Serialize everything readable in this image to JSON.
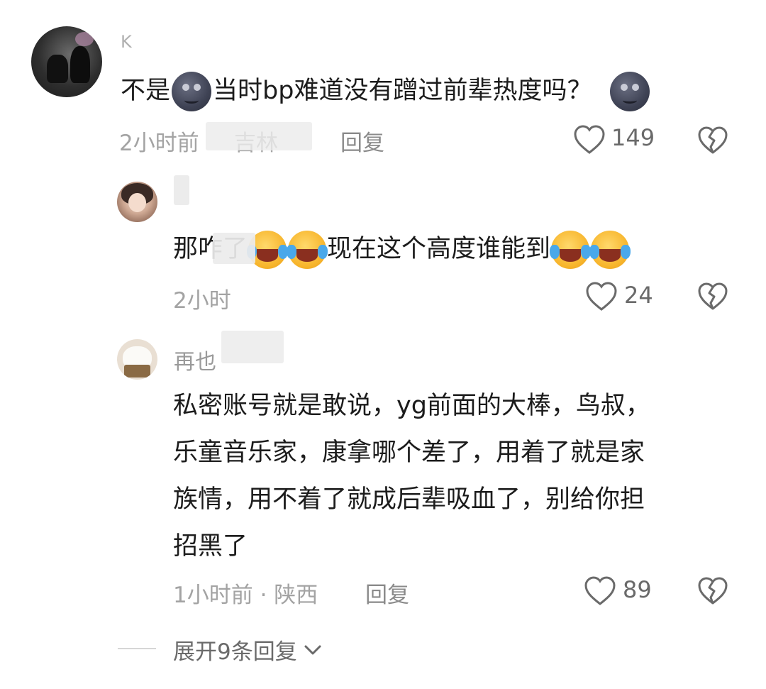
{
  "comments": [
    {
      "name": "K",
      "text_a": "不是",
      "text_b": "当时bp难道没有蹭过前辈热度吗？",
      "time": "2小时前",
      "location": "吉林",
      "reply": "回复",
      "likes": "149",
      "emoji_a": "new-moon-face-emoji",
      "emoji_b": "new-moon-face-emoji"
    }
  ],
  "replies": [
    {
      "name": "",
      "text_a": "那咋了",
      "text_b": "现在这个高度谁能到",
      "time": "2小时",
      "likes": "24",
      "emoji": "rolling-on-floor-laughing-emoji"
    },
    {
      "name": "再也",
      "lines": [
        "私密账号就是敢说，yg前面的大棒，鸟叔，",
        "乐童音乐家，康拿哪个差了，用着了就是家",
        "族情，用不着了就成后辈吸血了，别给你担",
        "招黑了"
      ],
      "time": "1小时前 · 陕西",
      "reply": "回复",
      "likes": "89"
    }
  ],
  "expand": "展开9条回复",
  "colors": {
    "text": "#1c1c1c",
    "meta": "#a3a3a3",
    "icon": "#6a6a6a"
  }
}
